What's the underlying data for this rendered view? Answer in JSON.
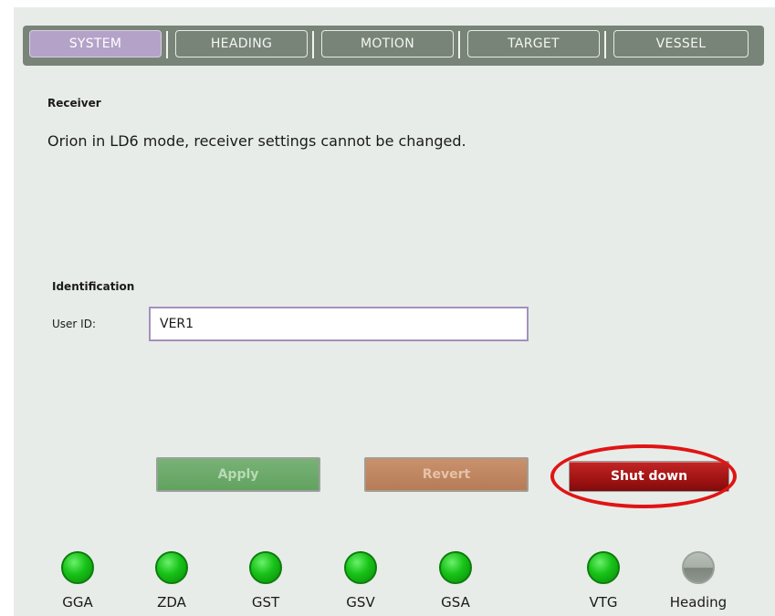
{
  "tabs": [
    {
      "label": "SYSTEM",
      "active": true
    },
    {
      "label": "HEADING",
      "active": false
    },
    {
      "label": "MOTION",
      "active": false
    },
    {
      "label": "TARGET",
      "active": false
    },
    {
      "label": "VESSEL",
      "active": false
    }
  ],
  "receiver": {
    "heading": "Receiver",
    "message": "Orion in LD6 mode, receiver settings cannot be changed."
  },
  "identification": {
    "heading": "Identification",
    "user_id_label": "User ID:",
    "user_id_value": "VER1"
  },
  "buttons": {
    "apply": "Apply",
    "revert": "Revert",
    "shutdown": "Shut down"
  },
  "indicators": [
    {
      "label": "GGA",
      "state": "on"
    },
    {
      "label": "ZDA",
      "state": "on"
    },
    {
      "label": "GST",
      "state": "on"
    },
    {
      "label": "GSV",
      "state": "on"
    },
    {
      "label": "GSA",
      "state": "on"
    },
    {
      "label": "VTG",
      "state": "on"
    },
    {
      "label": "Heading",
      "state": "off"
    }
  ],
  "colors": {
    "tabbar": "#788477",
    "active_tab": "#b4a2c8",
    "indicator_on": "#17c217",
    "highlight": "#e01414"
  }
}
